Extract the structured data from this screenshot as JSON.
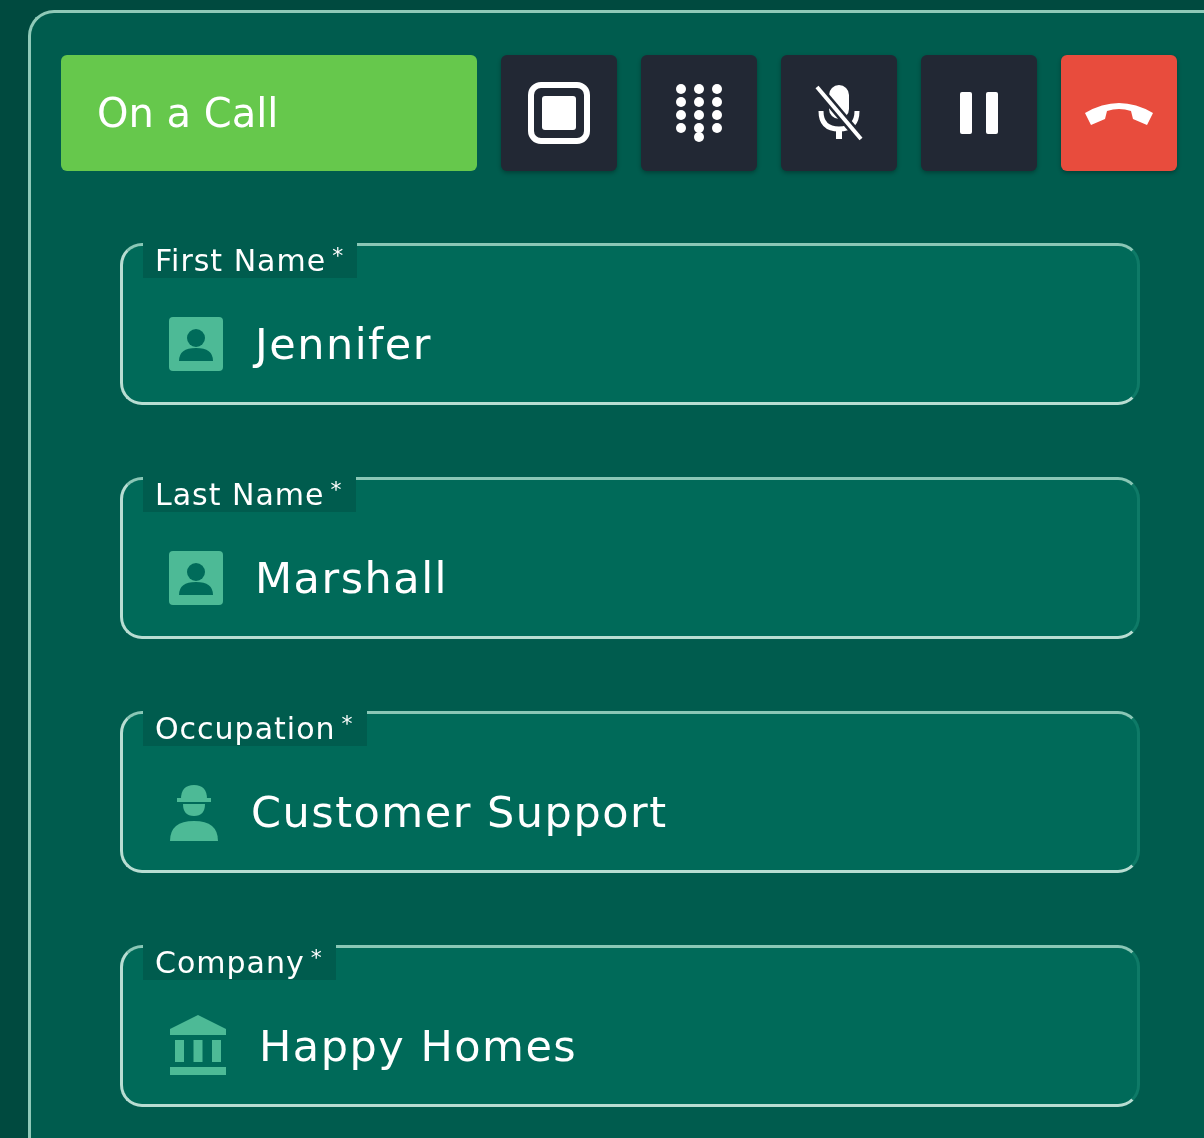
{
  "status": {
    "label": "On a Call"
  },
  "controls": [
    {
      "kind": "stop"
    },
    {
      "kind": "keypad"
    },
    {
      "kind": "mute"
    },
    {
      "kind": "pause"
    },
    {
      "kind": "hangup"
    }
  ],
  "fields": [
    {
      "label": "First Name",
      "required_mark": "*",
      "value": "Jennifer",
      "kind": "contact"
    },
    {
      "label": "Last Name",
      "required_mark": "*",
      "value": "Marshall",
      "kind": "contact"
    },
    {
      "label": "Occupation",
      "required_mark": "*",
      "value": "Customer Support",
      "kind": "worker"
    },
    {
      "label": "Company",
      "required_mark": "*",
      "value": "Happy Homes",
      "kind": "bank"
    }
  ]
}
